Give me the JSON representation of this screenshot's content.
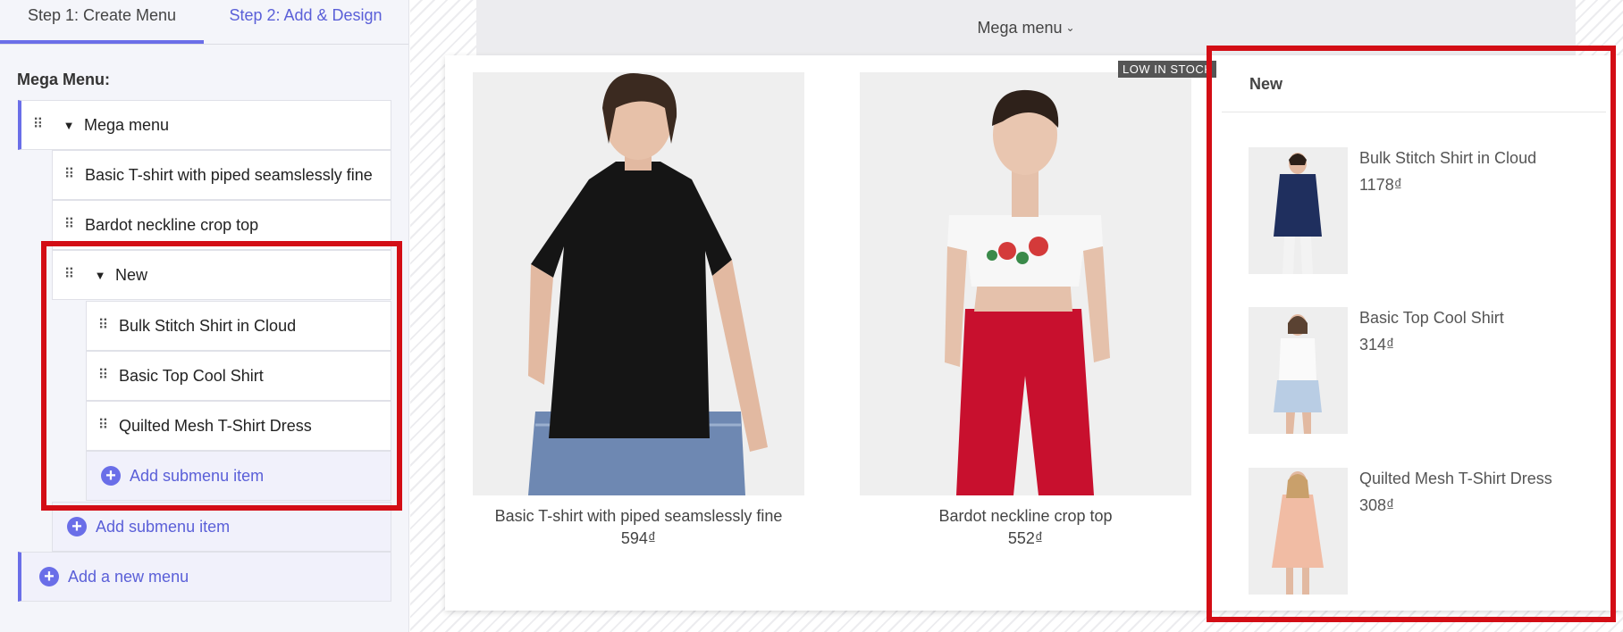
{
  "tabs": [
    "Step 1: Create Menu",
    "Step 2: Add & Design"
  ],
  "sidebar": {
    "heading": "Mega Menu:",
    "items": [
      "Mega menu",
      "Basic T-shirt with piped seamslessly fine",
      "Bardot neckline crop top",
      "New",
      "Bulk Stitch Shirt in Cloud",
      "Basic Top Cool Shirt",
      "Quilted Mesh T-Shirt Dress"
    ],
    "add_submenu_inner": "Add submenu item",
    "add_submenu_outer": "Add submenu item",
    "add_menu": "Add a new menu"
  },
  "preview": {
    "menu_title": "Mega menu",
    "badge": "LOW IN STOCK",
    "products": [
      {
        "name": "Basic T-shirt with piped seamslessly fine",
        "price": "594₫"
      },
      {
        "name": "Bardot neckline crop top",
        "price": "552₫"
      }
    ],
    "new_title": "New",
    "new_items": [
      {
        "name": "Bulk Stitch Shirt in Cloud",
        "price": "1178₫"
      },
      {
        "name": "Basic Top Cool Shirt",
        "price": "314₫"
      },
      {
        "name": "Quilted Mesh T-Shirt Dress",
        "price": "308₫"
      }
    ]
  },
  "colors": {
    "accent": "#6a6ee8",
    "highlight": "#d30d15"
  }
}
